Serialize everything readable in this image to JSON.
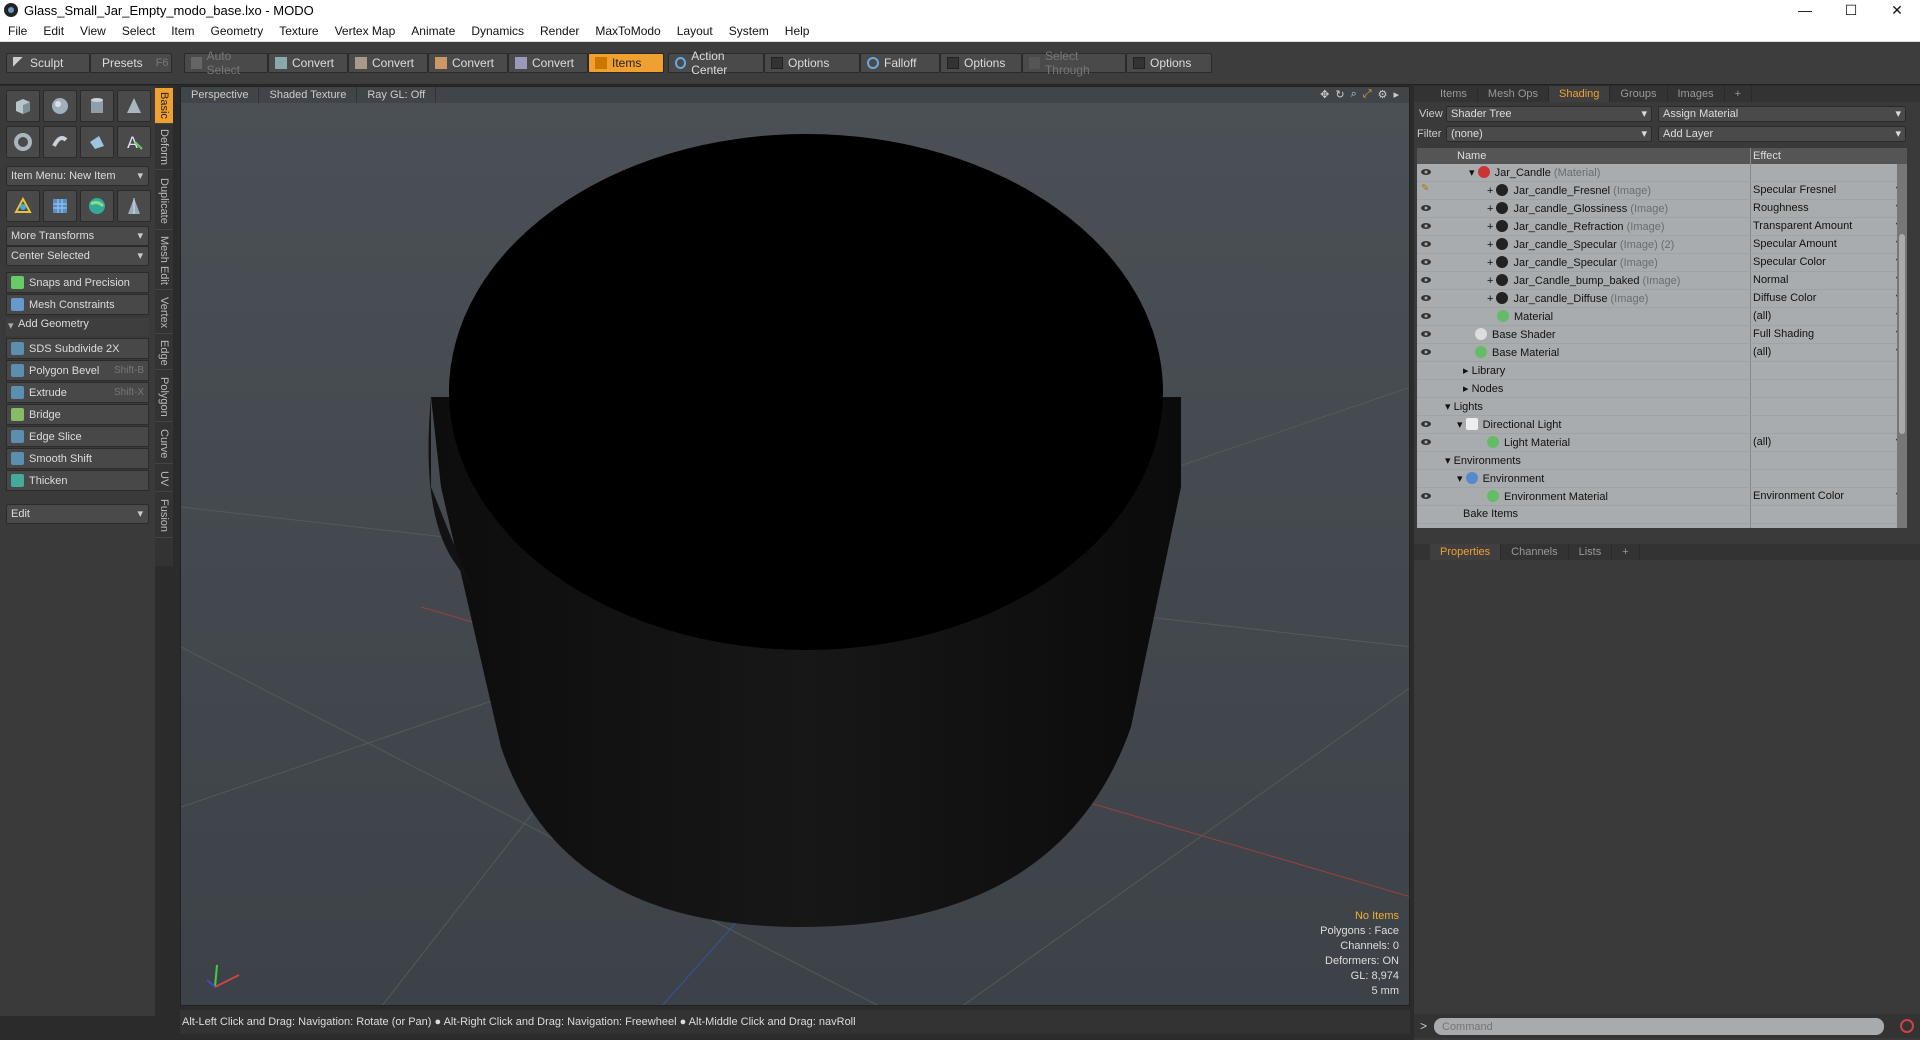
{
  "window": {
    "title": "Glass_Small_Jar_Empty_modo_base.lxo - MODO",
    "min": "—",
    "max": "☐",
    "close": "✕"
  },
  "menu": [
    "File",
    "Edit",
    "View",
    "Select",
    "Item",
    "Geometry",
    "Texture",
    "Vertex Map",
    "Animate",
    "Dynamics",
    "Render",
    "MaxToModo",
    "Layout",
    "System",
    "Help"
  ],
  "toolbar": {
    "sculpt": "Sculpt",
    "presets": "Presets",
    "presets_key": "F6",
    "auto_select": "Auto Select",
    "convert": "Convert",
    "items": "Items",
    "action_center": "Action Center",
    "options": "Options",
    "falloff": "Falloff",
    "select_through": "Select Through"
  },
  "left": {
    "item_menu": "Item Menu: New Item",
    "more_transforms": "More Transforms",
    "center_selected": "Center Selected",
    "snaps": "Snaps and Precision",
    "constraints": "Mesh Constraints",
    "add_geometry": "Add Geometry",
    "tools": [
      {
        "label": "SDS Subdivide 2X",
        "shortcut": ""
      },
      {
        "label": "Polygon Bevel",
        "shortcut": "Shift-B"
      },
      {
        "label": "Extrude",
        "shortcut": "Shift-X"
      },
      {
        "label": "Bridge",
        "shortcut": ""
      },
      {
        "label": "Edge Slice",
        "shortcut": ""
      },
      {
        "label": "Smooth Shift",
        "shortcut": ""
      },
      {
        "label": "Thicken",
        "shortcut": ""
      }
    ],
    "edit": "Edit"
  },
  "vtabs": [
    "Basic",
    "Deform",
    "Duplicate",
    "Mesh Edit",
    "Vertex",
    "Edge",
    "Polygon",
    "Curve",
    "UV",
    "Fusion"
  ],
  "viewport": {
    "view": "Perspective",
    "shading": "Shaded Texture",
    "raygl": "Ray GL: Off",
    "stats": {
      "items": "No Items",
      "polygons": "Polygons : Face",
      "channels": "Channels: 0",
      "deformers": "Deformers: ON",
      "gl": "GL: 8,974",
      "unit": "5 mm"
    }
  },
  "status": "Alt-Left Click and Drag: Navigation: Rotate (or Pan) ● Alt-Right Click and Drag: Navigation: Freewheel ● Alt-Middle Click and Drag: navRoll",
  "right": {
    "tabs": [
      "Items",
      "Mesh Ops",
      "Shading",
      "Groups",
      "Images",
      "+"
    ],
    "view_label": "View",
    "view_value": "Shader Tree",
    "assign": "Assign Material",
    "filter_label": "Filter",
    "filter_value": "(none)",
    "add_layer": "Add Layer",
    "col_name": "Name",
    "col_effect": "Effect",
    "rows": [
      {
        "name": "Jar_Candle",
        "type": "(Material)",
        "effect": ""
      },
      {
        "name": "Jar_candle_Fresnel",
        "type": "(Image)",
        "effect": "Specular Fresnel"
      },
      {
        "name": "Jar_candle_Glossiness",
        "type": "(Image)",
        "effect": "Roughness"
      },
      {
        "name": "Jar_candle_Refraction",
        "type": "(Image)",
        "effect": "Transparent Amount"
      },
      {
        "name": "Jar_candle_Specular",
        "type": "(Image) (2)",
        "effect": "Specular Amount"
      },
      {
        "name": "Jar_candle_Specular",
        "type": "(Image)",
        "effect": "Specular Color"
      },
      {
        "name": "Jar_Candle_bump_baked",
        "type": "(Image)",
        "effect": "Normal"
      },
      {
        "name": "Jar_candle_Diffuse",
        "type": "(Image)",
        "effect": "Diffuse Color"
      },
      {
        "name": "Material",
        "type": "",
        "effect": "(all)"
      },
      {
        "name": "Base Shader",
        "type": "",
        "effect": "Full Shading"
      },
      {
        "name": "Base Material",
        "type": "",
        "effect": "(all)"
      },
      {
        "name": "Library",
        "type": "",
        "effect": ""
      },
      {
        "name": "Nodes",
        "type": "",
        "effect": ""
      },
      {
        "name": "Lights",
        "type": "",
        "effect": ""
      },
      {
        "name": "Directional Light",
        "type": "",
        "effect": ""
      },
      {
        "name": "Light Material",
        "type": "",
        "effect": "(all)"
      },
      {
        "name": "Environments",
        "type": "",
        "effect": ""
      },
      {
        "name": "Environment",
        "type": "",
        "effect": ""
      },
      {
        "name": "Environment Material",
        "type": "",
        "effect": "Environment Color"
      },
      {
        "name": "Bake Items",
        "type": "",
        "effect": ""
      }
    ],
    "prop_tabs": [
      "Properties",
      "Channels",
      "Lists",
      "+"
    ],
    "command_placeholder": "Command"
  }
}
